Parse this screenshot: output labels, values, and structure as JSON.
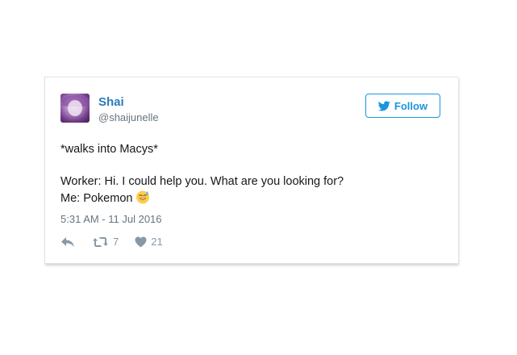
{
  "user": {
    "name": "Shai",
    "handle": "@shaijunelle"
  },
  "follow_button": {
    "label": "Follow",
    "icon": "twitter-bird-icon",
    "color": "#1b95e0"
  },
  "tweet": {
    "line1": "*walks into Macys*",
    "line2": "Worker: Hi. I could help you. What are you looking for?",
    "line3": "Me: Pokemon",
    "emoji": "grinning-sweat-emoji",
    "timestamp": "5:31 AM - 11 Jul 2016"
  },
  "actions": {
    "reply_icon": "reply-icon",
    "retweet_icon": "retweet-icon",
    "retweet_count": "7",
    "like_icon": "heart-icon",
    "like_count": "21"
  },
  "colors": {
    "name": "#2b7bb9",
    "secondary_text": "#66757f",
    "action_gray": "#8899a6"
  }
}
